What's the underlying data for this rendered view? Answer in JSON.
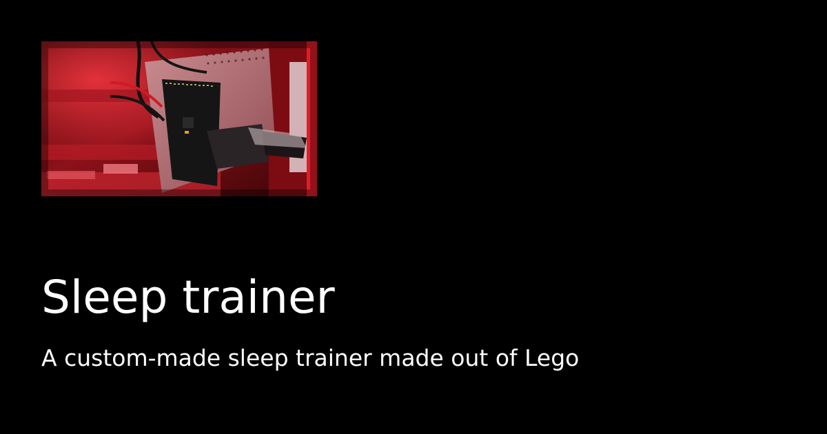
{
  "page": {
    "title": "Sleep trainer",
    "subtitle": "A custom-made sleep trainer made out of Lego"
  },
  "image": {
    "subject": "red-lit-electronics-board-photo"
  },
  "colors": {
    "background": "#000000",
    "text": "#ffffff",
    "photo_accent": "#e01e2b"
  }
}
